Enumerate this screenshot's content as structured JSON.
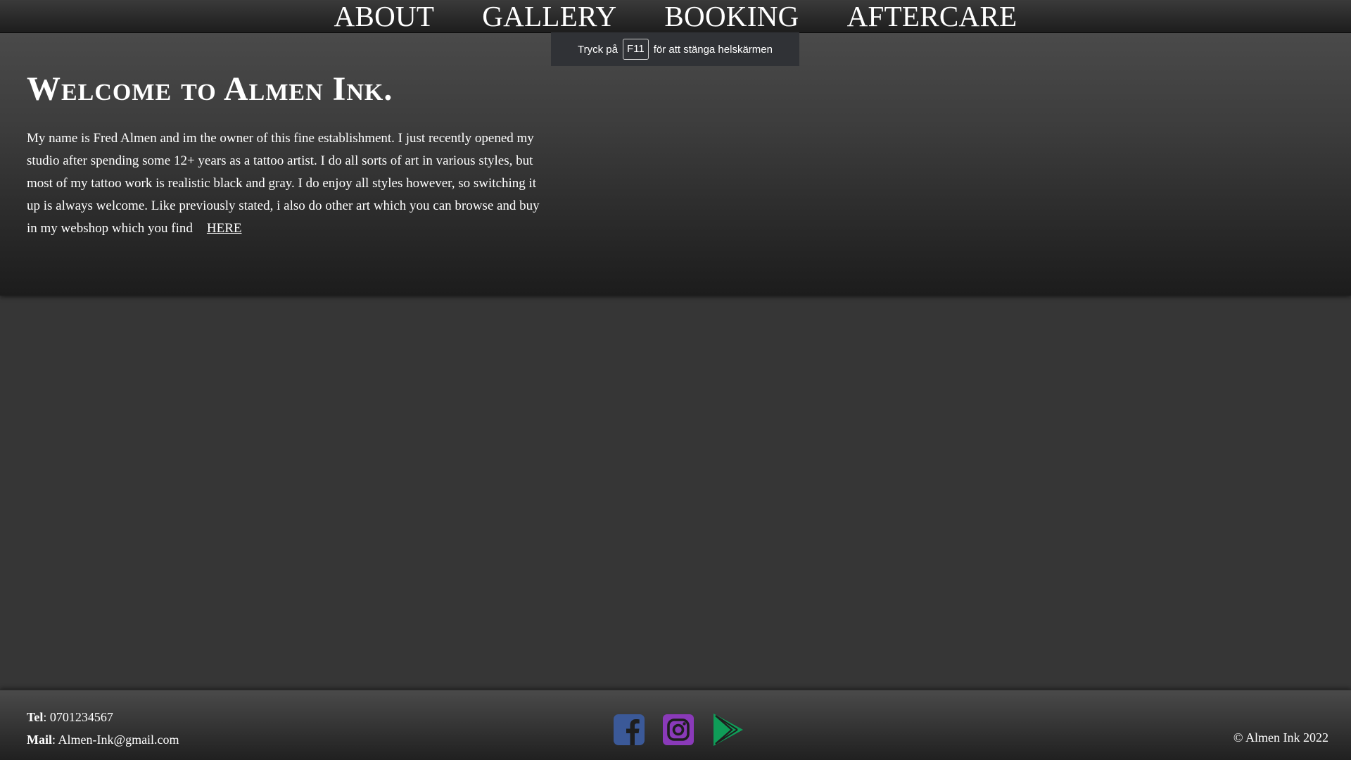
{
  "nav": {
    "items": [
      {
        "label": "ABOUT"
      },
      {
        "label": "GALLERY"
      },
      {
        "label": "BOOKING"
      },
      {
        "label": "AFTERCARE"
      }
    ]
  },
  "fullscreen_notice": {
    "before": "Tryck på",
    "key": "F11",
    "after": "för att stänga helskärmen"
  },
  "hero": {
    "title": "Welcome to Almen Ink.",
    "body": "My name is Fred Almen and im the owner of this fine establishment. I just recently opened my studio after spending some 12+ years as a tattoo artist. I do all sorts of art in various styles, but most of my tattoo work is realistic black and gray. I do enjoy all styles however, so switching it up is always welcome. Like previously stated, i also do other art which you can browse and buy in my webshop which you find",
    "link_label": "HERE"
  },
  "footer": {
    "tel_label": "Tel",
    "tel_value": ": 0701234567",
    "mail_label": "Mail",
    "mail_value": ": Almen-Ink@gmail.com",
    "copyright": "© Almen Ink 2022",
    "socials": [
      {
        "icon": "facebook-icon",
        "color": "#3b5998"
      },
      {
        "icon": "instagram-icon",
        "color": "#8a3ab9"
      },
      {
        "icon": "google-play-icon",
        "color": "#0f9d58"
      }
    ]
  },
  "colors": {
    "page_background": "#363636",
    "text": "#ffffff"
  }
}
